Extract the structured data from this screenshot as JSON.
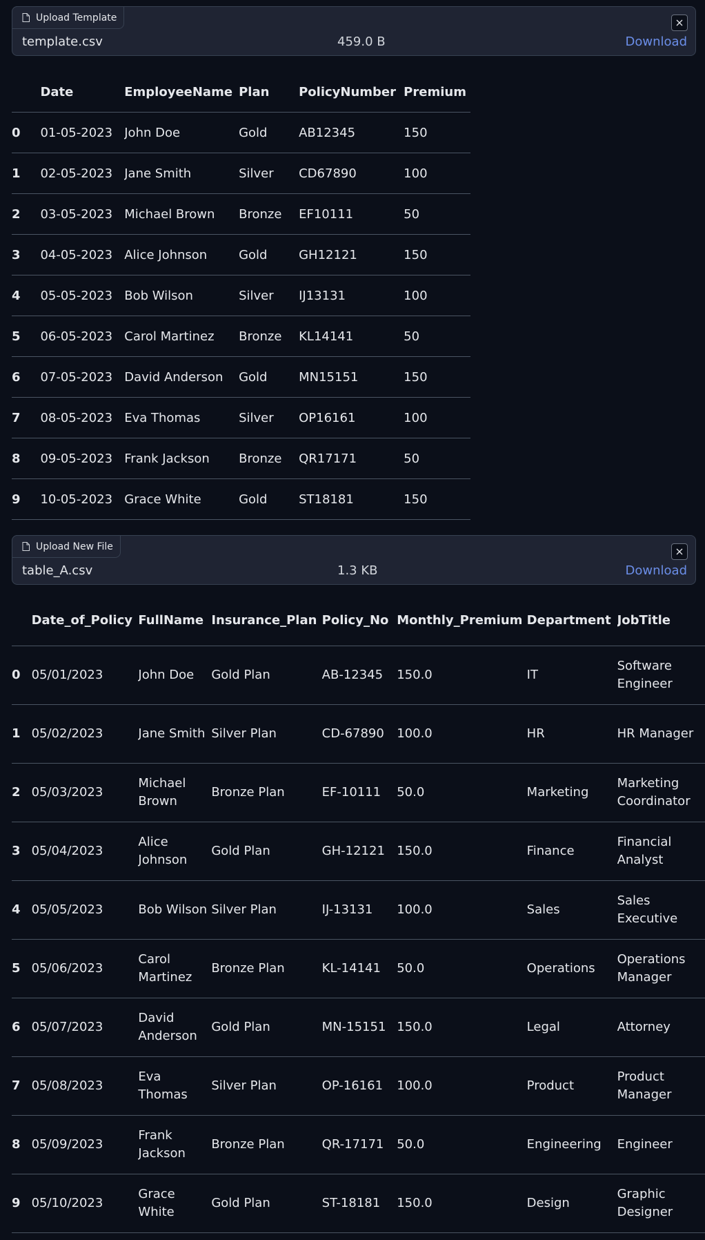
{
  "card1": {
    "label": "Upload Template",
    "file_name": "template.csv",
    "file_size": "459.0 B",
    "download_label": "Download"
  },
  "table1": {
    "headers": [
      "",
      "Date",
      "EmployeeName",
      "Plan",
      "PolicyNumber",
      "Premium"
    ],
    "rows": [
      [
        "0",
        "01-05-2023",
        "John Doe",
        "Gold",
        "AB12345",
        "150"
      ],
      [
        "1",
        "02-05-2023",
        "Jane Smith",
        "Silver",
        "CD67890",
        "100"
      ],
      [
        "2",
        "03-05-2023",
        "Michael Brown",
        "Bronze",
        "EF10111",
        "50"
      ],
      [
        "3",
        "04-05-2023",
        "Alice Johnson",
        "Gold",
        "GH12121",
        "150"
      ],
      [
        "4",
        "05-05-2023",
        "Bob Wilson",
        "Silver",
        "IJ13131",
        "100"
      ],
      [
        "5",
        "06-05-2023",
        "Carol Martinez",
        "Bronze",
        "KL14141",
        "50"
      ],
      [
        "6",
        "07-05-2023",
        "David Anderson",
        "Gold",
        "MN15151",
        "150"
      ],
      [
        "7",
        "08-05-2023",
        "Eva Thomas",
        "Silver",
        "OP16161",
        "100"
      ],
      [
        "8",
        "09-05-2023",
        "Frank Jackson",
        "Bronze",
        "QR17171",
        "50"
      ],
      [
        "9",
        "10-05-2023",
        "Grace White",
        "Gold",
        "ST18181",
        "150"
      ]
    ]
  },
  "card2": {
    "label": "Upload New File",
    "file_name": "table_A.csv",
    "file_size": "1.3 KB",
    "download_label": "Download"
  },
  "table2": {
    "headers": [
      "",
      "Date_of_Policy",
      "FullName",
      "Insurance_Plan",
      "Policy_No",
      "Monthly_Premium",
      "Department",
      "JobTitle"
    ],
    "rows": [
      [
        "0",
        "05/01/2023",
        "John Doe",
        "Gold Plan",
        "AB-12345",
        "150.0",
        "IT",
        "Software Engineer"
      ],
      [
        "1",
        "05/02/2023",
        "Jane Smith",
        "Silver Plan",
        "CD-67890",
        "100.0",
        "HR",
        "HR Manager"
      ],
      [
        "2",
        "05/03/2023",
        "Michael Brown",
        "Bronze Plan",
        "EF-10111",
        "50.0",
        "Marketing",
        "Marketing Coordinator"
      ],
      [
        "3",
        "05/04/2023",
        "Alice Johnson",
        "Gold Plan",
        "GH-12121",
        "150.0",
        "Finance",
        "Financial Analyst"
      ],
      [
        "4",
        "05/05/2023",
        "Bob Wilson",
        "Silver Plan",
        "IJ-13131",
        "100.0",
        "Sales",
        "Sales Executive"
      ],
      [
        "5",
        "05/06/2023",
        "Carol Martinez",
        "Bronze Plan",
        "KL-14141",
        "50.0",
        "Operations",
        "Operations Manager"
      ],
      [
        "6",
        "05/07/2023",
        "David Anderson",
        "Gold Plan",
        "MN-15151",
        "150.0",
        "Legal",
        "Attorney"
      ],
      [
        "7",
        "05/08/2023",
        "Eva Thomas",
        "Silver Plan",
        "OP-16161",
        "100.0",
        "Product",
        "Product Manager"
      ],
      [
        "8",
        "05/09/2023",
        "Frank Jackson",
        "Bronze Plan",
        "QR-17171",
        "50.0",
        "Engineering",
        "Engineer"
      ],
      [
        "9",
        "05/10/2023",
        "Grace White",
        "Gold Plan",
        "ST-18181",
        "150.0",
        "Design",
        "Graphic Designer"
      ]
    ]
  }
}
